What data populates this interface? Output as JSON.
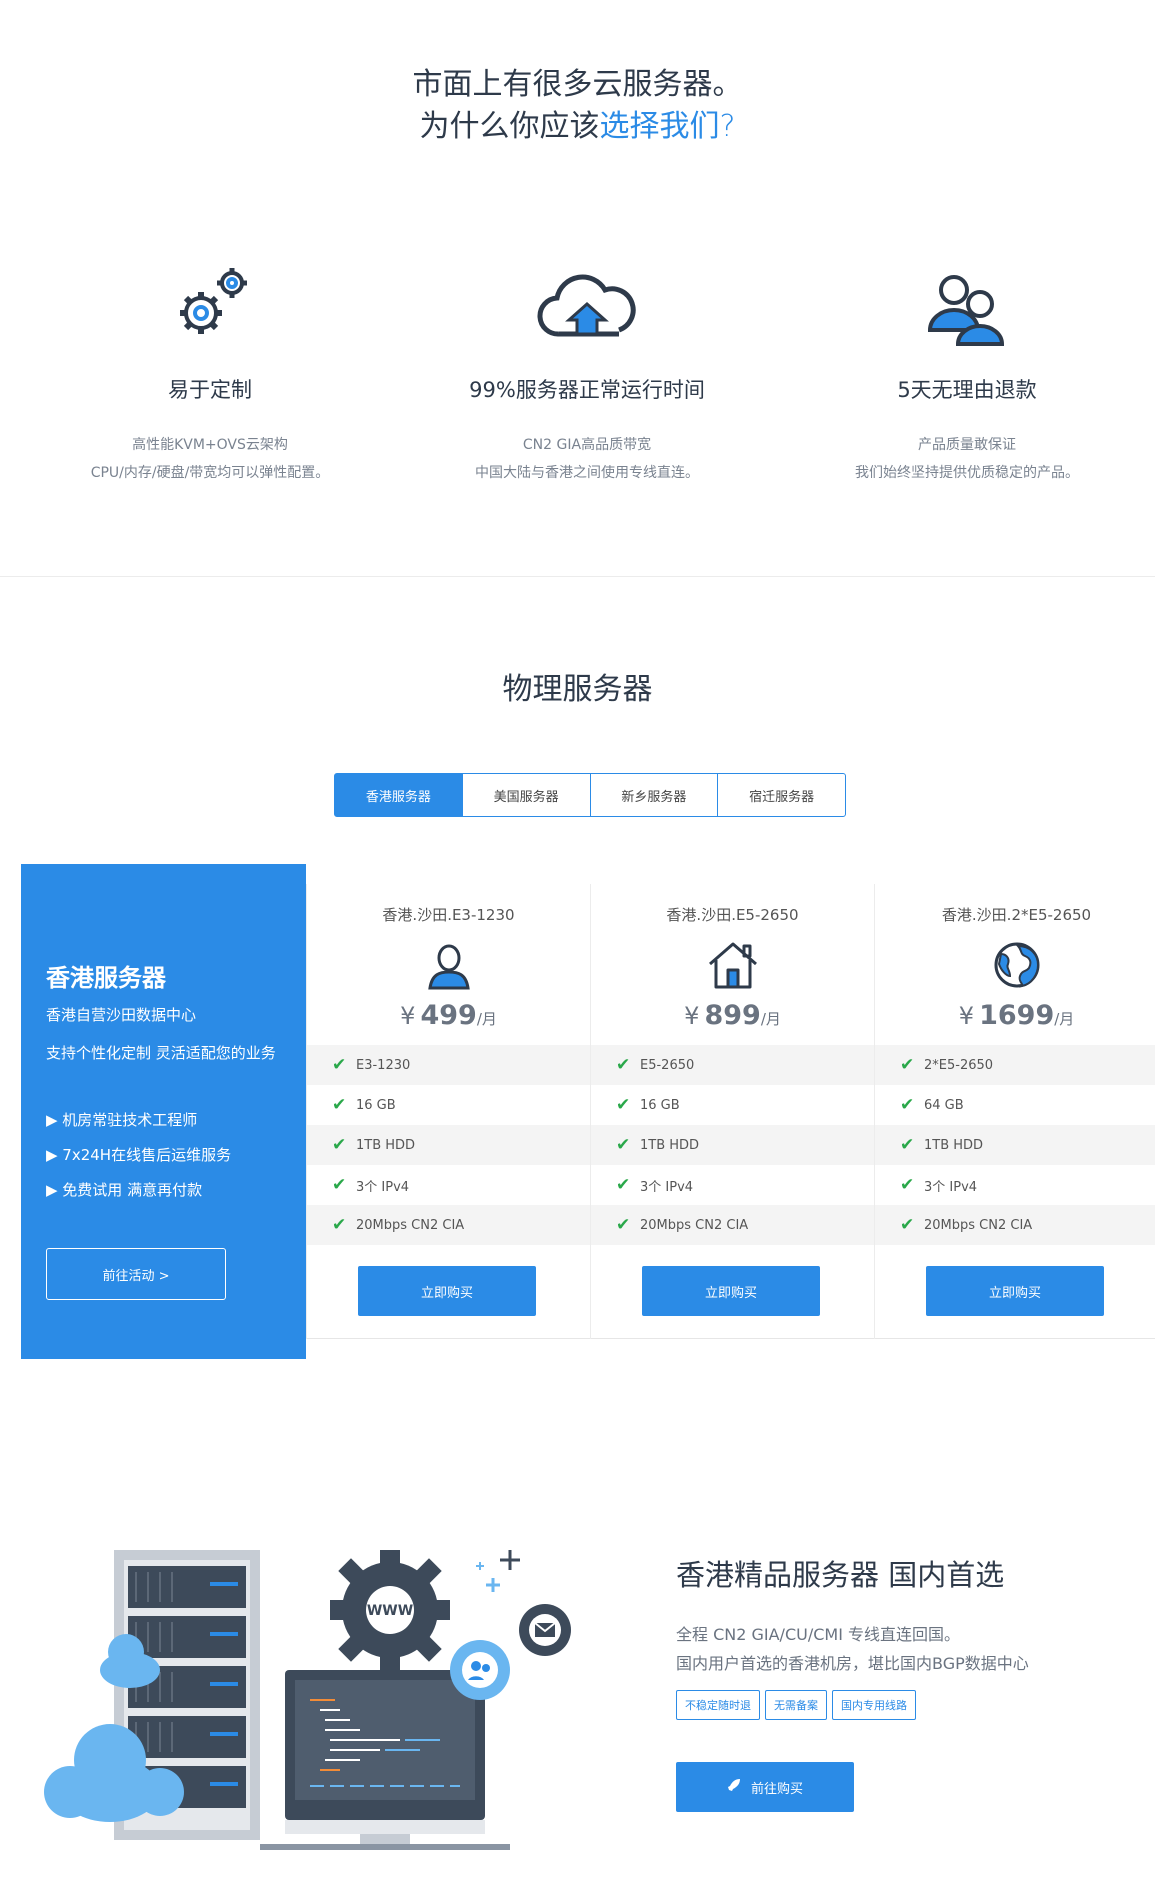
{
  "hero": {
    "line1": "市面上有很多云服务器。",
    "line2_prefix": "为什么你应该",
    "line2_highlight": "选择我们?"
  },
  "features": [
    {
      "icon": "gears-icon",
      "title": "易于定制",
      "desc1": "高性能KVM+OVS云架构",
      "desc2": "CPU/内存/硬盘/带宽均可以弹性配置。"
    },
    {
      "icon": "cloud-upload-icon",
      "title": "99%服务器正常运行时间",
      "desc1": "CN2 GIA高品质带宽",
      "desc2": "中国大陆与香港之间使用专线直连。"
    },
    {
      "icon": "users-icon",
      "title": "5天无理由退款",
      "desc1": "产品质量敢保证",
      "desc2": "我们始终坚持提供优质稳定的产品。"
    }
  ],
  "physical": {
    "title": "物理服务器",
    "tabs": [
      "香港服务器",
      "美国服务器",
      "新乡服务器",
      "宿迁服务器"
    ],
    "active_tab": "香港服务器"
  },
  "promo": {
    "title": "香港服务器",
    "subtitle": "香港自营沙田数据中心",
    "desc": "支持个性化定制 灵活适配您的业务",
    "bullets": [
      "▶ 机房常驻技术工程师",
      "▶ 7x24H在线售后运维服务",
      "▶ 免费试用 满意再付款"
    ],
    "button": "前往活动 >"
  },
  "plans": [
    {
      "name": "香港.沙田.E3-1230",
      "icon": "user-icon",
      "currency": "¥",
      "price": "499",
      "unit": "/月",
      "specs": [
        "E3-1230",
        "16 GB",
        "1TB HDD",
        "3个 IPv4",
        "20Mbps CN2 CIA"
      ],
      "buy": "立即购买"
    },
    {
      "name": "香港.沙田.E5-2650",
      "icon": "house-icon",
      "currency": "¥",
      "price": "899",
      "unit": "/月",
      "specs": [
        "E5-2650",
        "16 GB",
        "1TB HDD",
        "3个 IPv4",
        "20Mbps CN2 CIA"
      ],
      "buy": "立即购买"
    },
    {
      "name": "香港.沙田.2*E5-2650",
      "icon": "globe-icon",
      "currency": "¥",
      "price": "1699",
      "unit": "/月",
      "specs": [
        "2*E5-2650",
        "64 GB",
        "1TB HDD",
        "3个 IPv4",
        "20Mbps CN2 CIA"
      ],
      "buy": "立即购买"
    }
  ],
  "hk": {
    "title": "香港精品服务器 国内首选",
    "desc1": "全程 CN2 GIA/CU/CMI 专线直连回国。",
    "desc2": "国内用户首选的香港机房，堪比国内BGP数据中心",
    "tags": [
      "不稳定随时退",
      "无需备案",
      "国内专用线路"
    ],
    "button": "前往购买",
    "illustration_label": "WWW"
  },
  "colors": {
    "accent": "#2b8be6",
    "heading": "#2e3a4a",
    "muted": "#7a8390",
    "check": "#2aa84a"
  }
}
